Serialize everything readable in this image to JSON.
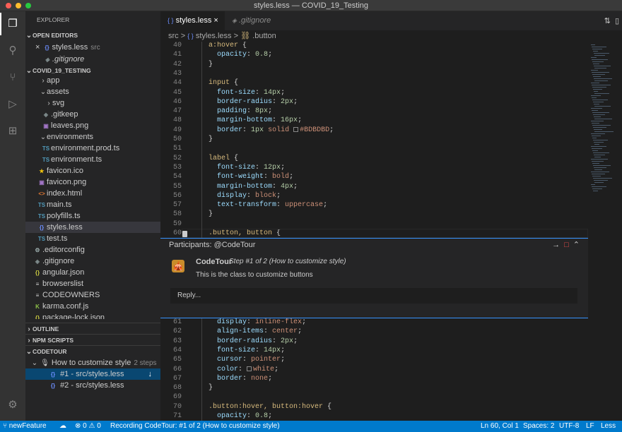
{
  "window": {
    "title": "styles.less — COVID_19_Testing"
  },
  "activity_bar": {
    "icons": [
      "files-icon",
      "search-icon",
      "source-control-icon",
      "run-debug-icon",
      "extensions-icon",
      "settings-gear-icon"
    ]
  },
  "sidebar": {
    "title": "EXPLORER",
    "open_editors": {
      "label": "OPEN EDITORS",
      "items": [
        {
          "name": "styles.less",
          "desc": "src"
        },
        {
          "name": ".gitignore"
        }
      ]
    },
    "project": {
      "label": "COVID_19_TESTING"
    },
    "tree": [
      {
        "name": "app"
      },
      {
        "name": "assets"
      },
      {
        "name": "svg"
      },
      {
        "name": ".gitkeep"
      },
      {
        "name": "leaves.png"
      },
      {
        "name": "environments"
      },
      {
        "name": "environment.prod.ts"
      },
      {
        "name": "environment.ts"
      },
      {
        "name": "favicon.ico"
      },
      {
        "name": "favicon.png"
      },
      {
        "name": "index.html"
      },
      {
        "name": "main.ts"
      },
      {
        "name": "polyfills.ts"
      },
      {
        "name": "styles.less"
      },
      {
        "name": "test.ts"
      },
      {
        "name": ".editorconfig"
      },
      {
        "name": ".gitignore"
      },
      {
        "name": "angular.json"
      },
      {
        "name": "browserslist"
      },
      {
        "name": "CODEOWNERS"
      },
      {
        "name": "karma.conf.js"
      },
      {
        "name": "package-lock.json"
      }
    ],
    "outline": "OUTLINE",
    "npm": "NPM SCRIPTS",
    "codetour": {
      "label": "CODETOUR",
      "tour": "How to customize style",
      "tour_steps": "2 steps",
      "steps": [
        "#1 - src/styles.less",
        "#2 - src/styles.less"
      ]
    }
  },
  "tabs": [
    {
      "label": "styles.less",
      "icon": "{ }",
      "close": "×"
    },
    {
      "label": ".gitignore",
      "icon": "◈"
    }
  ],
  "breadcrumb": {
    "part1": "src",
    "sep": ">",
    "part2": "styles.less",
    "part3": ".button",
    "icon2": "{ }",
    "icon3": "⛓"
  },
  "editor_top": {
    "lines": [
      {
        "n": "40",
        "t": "  a:hover {"
      },
      {
        "n": "41",
        "t": "    opacity: 0.8;"
      },
      {
        "n": "42",
        "t": "  }"
      },
      {
        "n": "43",
        "t": ""
      },
      {
        "n": "44",
        "t": "  input {"
      },
      {
        "n": "45",
        "t": "    font-size: 14px;"
      },
      {
        "n": "46",
        "t": "    border-radius: 2px;"
      },
      {
        "n": "47",
        "t": "    padding: 8px;"
      },
      {
        "n": "48",
        "t": "    margin-bottom: 16px;"
      },
      {
        "n": "49",
        "t": "    border: 1px solid ■#BDBDBD;"
      },
      {
        "n": "50",
        "t": "  }"
      },
      {
        "n": "51",
        "t": ""
      },
      {
        "n": "52",
        "t": "  label {"
      },
      {
        "n": "53",
        "t": "    font-size: 12px;"
      },
      {
        "n": "54",
        "t": "    font-weight: bold;"
      },
      {
        "n": "55",
        "t": "    margin-bottom: 4px;"
      },
      {
        "n": "56",
        "t": "    display: block;"
      },
      {
        "n": "57",
        "t": "    text-transform: uppercase;"
      },
      {
        "n": "58",
        "t": "  }"
      },
      {
        "n": "59",
        "t": ""
      },
      {
        "n": "60",
        "t": "  .button, button {"
      }
    ]
  },
  "peek": {
    "header": "Participants: @CodeTour",
    "author": "CodeTour",
    "step": "Step #1 of 2 (How to customize style)",
    "message": "This is the class to customize buttons",
    "reply_placeholder": "Reply..."
  },
  "editor_bottom": {
    "lines": [
      {
        "n": "61",
        "t": "    display: inline-flex;"
      },
      {
        "n": "62",
        "t": "    align-items: center;"
      },
      {
        "n": "63",
        "t": "    border-radius: 2px;"
      },
      {
        "n": "64",
        "t": "    font-size: 14px;"
      },
      {
        "n": "65",
        "t": "    cursor: pointer;"
      },
      {
        "n": "66",
        "t": "    color: ■white;"
      },
      {
        "n": "67",
        "t": "    border: none;"
      },
      {
        "n": "68",
        "t": "  }"
      },
      {
        "n": "69",
        "t": ""
      },
      {
        "n": "70",
        "t": "  .button:hover, button:hover {"
      },
      {
        "n": "71",
        "t": "    opacity: 0.8;"
      }
    ]
  },
  "status": {
    "branch": "newFeature",
    "errors": "0",
    "warnings": "0",
    "recording": "Recording CodeTour: #1 of 2 (How to customize style)",
    "position": "Ln 60, Col 1",
    "spaces": "Spaces: 2",
    "encoding": "UTF-8",
    "eol": "LF",
    "language": "Less"
  },
  "colors": {
    "accent": "#007acc",
    "peek_border": "#3794ff",
    "selection": "#094771"
  }
}
